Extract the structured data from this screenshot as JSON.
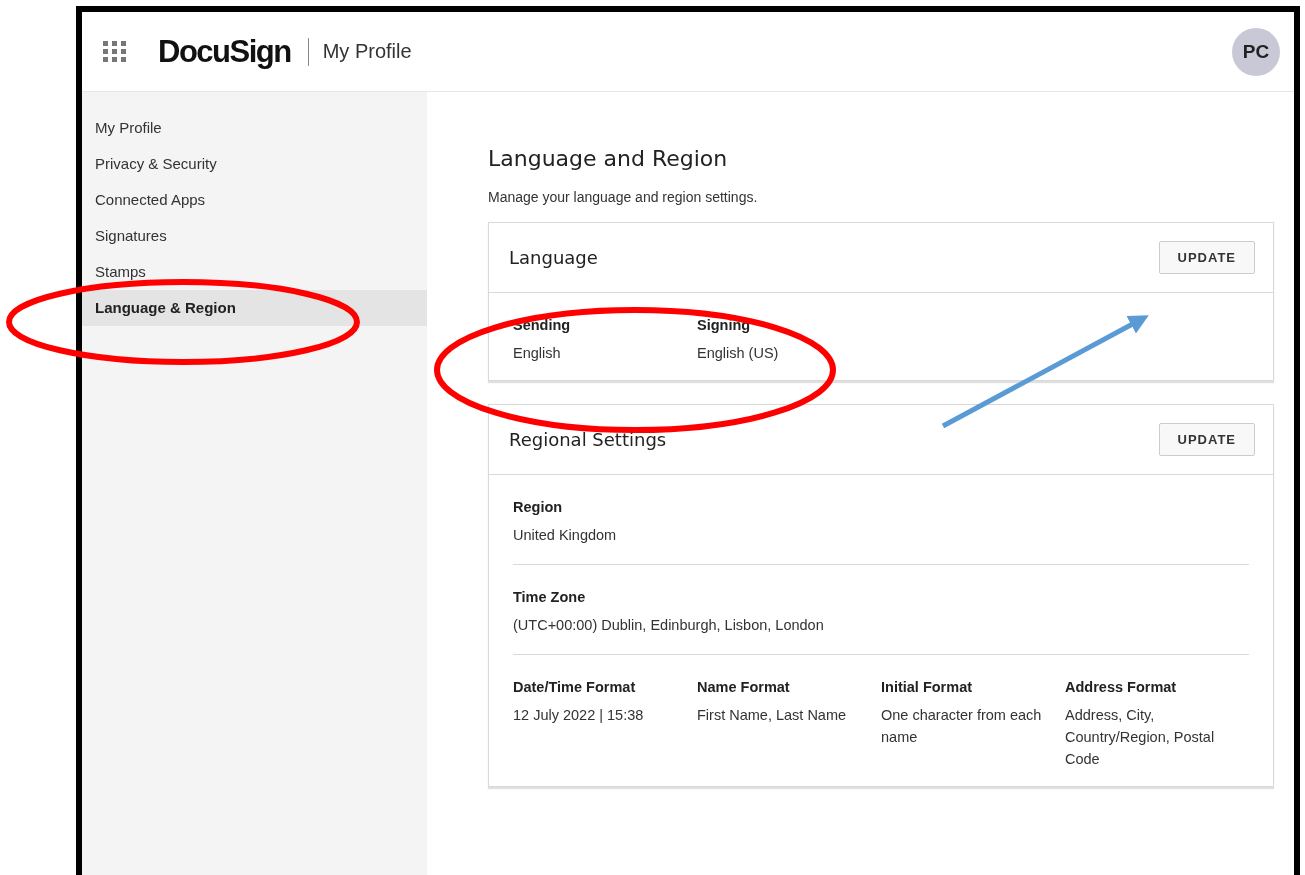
{
  "header": {
    "app_name": "DocuSign",
    "page_title": "My Profile",
    "avatar_initials": "PC"
  },
  "sidebar": {
    "items": [
      {
        "label": "My Profile",
        "selected": false
      },
      {
        "label": "Privacy & Security",
        "selected": false
      },
      {
        "label": "Connected Apps",
        "selected": false
      },
      {
        "label": "Signatures",
        "selected": false
      },
      {
        "label": "Stamps",
        "selected": false
      },
      {
        "label": "Language & Region",
        "selected": true
      }
    ]
  },
  "main": {
    "heading": "Language and Region",
    "description": "Manage your language and region settings.",
    "sections": [
      {
        "title": "Language",
        "button": "UPDATE",
        "rows": [
          [
            {
              "label": "Sending",
              "value": "English"
            },
            {
              "label": "Signing",
              "value": "English (US)"
            }
          ]
        ]
      },
      {
        "title": "Regional Settings",
        "button": "UPDATE",
        "rows": [
          [
            {
              "label": "Region",
              "value": "United Kingdom"
            }
          ],
          [
            {
              "label": "Time Zone",
              "value": "(UTC+00:00) Dublin, Edinburgh, Lisbon, London"
            }
          ],
          [
            {
              "label": "Date/Time Format",
              "value": "12 July 2022 | 15:38"
            },
            {
              "label": "Name Format",
              "value": "First Name, Last Name"
            },
            {
              "label": "Initial Format",
              "value": "One character from each name"
            },
            {
              "label": "Address Format",
              "value": "Address, City, Country/Region, Postal Code"
            }
          ]
        ]
      }
    ]
  }
}
